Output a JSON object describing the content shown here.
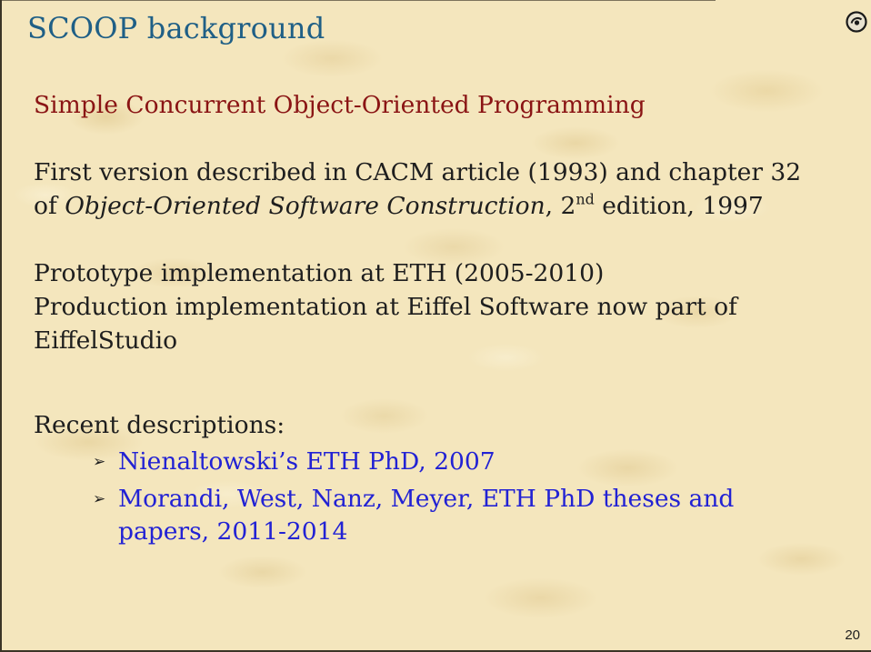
{
  "slide": {
    "title": "SCOOP background",
    "subtitle": "Simple Concurrent Object-Oriented Programming",
    "para1": {
      "line1": "First version described in CACM article (1993) and chapter 32",
      "line2_pre": "of ",
      "line2_book": "Object-Oriented Software Construction",
      "line2_mid": ", 2",
      "line2_sup": "nd",
      "line2_post": " edition, 1997"
    },
    "para2": {
      "line1": "Prototype implementation at ETH (2005-2010)",
      "line2": "Production implementation at Eiffel Software now part of",
      "line3": "EiffelStudio"
    },
    "recent_heading": "Recent descriptions:",
    "bullets": [
      {
        "marker": "➢",
        "text": "Nienaltowski’s ETH PhD, 2007"
      },
      {
        "marker": "➢",
        "text": "Morandi, West, Nanz, Meyer, ETH PhD theses and papers, 2011-2014"
      }
    ],
    "page_number": "20",
    "logo_icon": "eiffel-logo-icon",
    "colors": {
      "title": "#1f5f86",
      "subtitle": "#8a1414",
      "bullet_text": "#2222d4",
      "body_text": "#1e1e1e",
      "background": "#f4e6bd"
    }
  }
}
